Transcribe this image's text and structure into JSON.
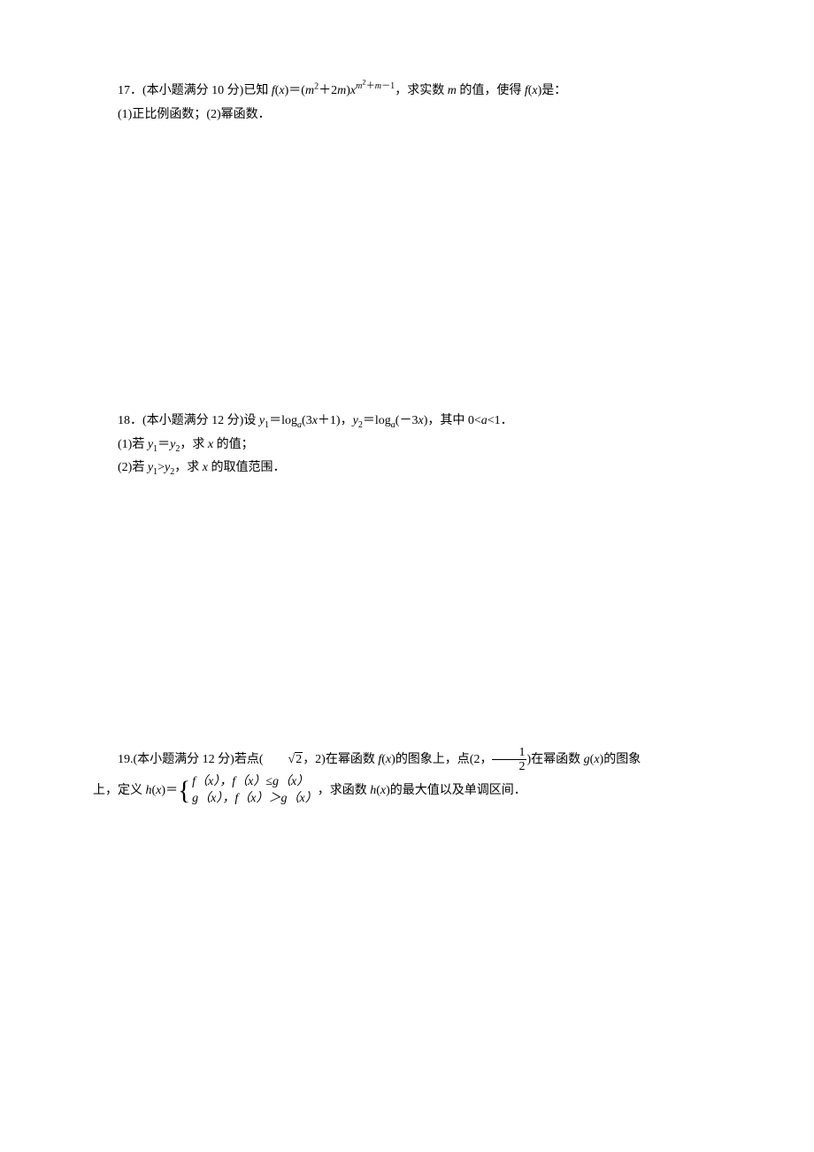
{
  "problems": {
    "p17": {
      "label": "17．",
      "prefix": "(本小题满分 10 分)已知 ",
      "fn": "f",
      "x": "x",
      "eq1": "＝(",
      "m": "m",
      "sq2_plus": "＋2",
      "m2": "m",
      "rp": ")",
      "x2": "x",
      "exp_m": "m",
      "exp_plus": "＋",
      "exp_m2": "m",
      "exp_minus1": "－1",
      "tail": "，求实数 ",
      "m_tail": "m",
      "tail2": " 的值，使得 ",
      "fn2": "f",
      "x3": "x",
      "tail3": "是：",
      "sub1": "(1)正比例函数；(2)幂函数．"
    },
    "p18": {
      "label": "18．",
      "prefix": "(本小题满分 12 分)设 ",
      "y": "y",
      "eqlog": "＝log",
      "a": "a",
      "arg1": "(3",
      "x": "x",
      "arg1b": "＋1)，",
      "y2": "y",
      "arg2a": "(－3",
      "arg2b": ")，其中 0<",
      "a2": "a",
      "tail": "<1．",
      "sub1a": "(1)若 ",
      "sub1b": "＝",
      "sub1c": "，求 ",
      "sub1d": " 的值；",
      "sub2a": "(2)若 ",
      "sub2c": "，求 ",
      "sub2d": " 的取值范围．"
    },
    "p19": {
      "label": "19.",
      "prefix": "(本小题满分 12 分)若点(",
      "sqrt2": "2",
      "comma2": "，2)在幂函数 ",
      "f": "f",
      "x": "x",
      "mid": "的图象上，点(2，",
      "half_num": "1",
      "half_den": "2",
      "mid2": ")在幂函数 ",
      "g": "g",
      "mid3": "的图象",
      "line2a": "上，定义",
      "h": "h",
      "hx_eq": "＝",
      "case1": "f（x），f（x）≤g（x）",
      "case2": "g（x），f（x）＞g（x）",
      "after": "，求函数 ",
      "h2": "h",
      "tail": "的最大值以及单调区间．"
    }
  }
}
